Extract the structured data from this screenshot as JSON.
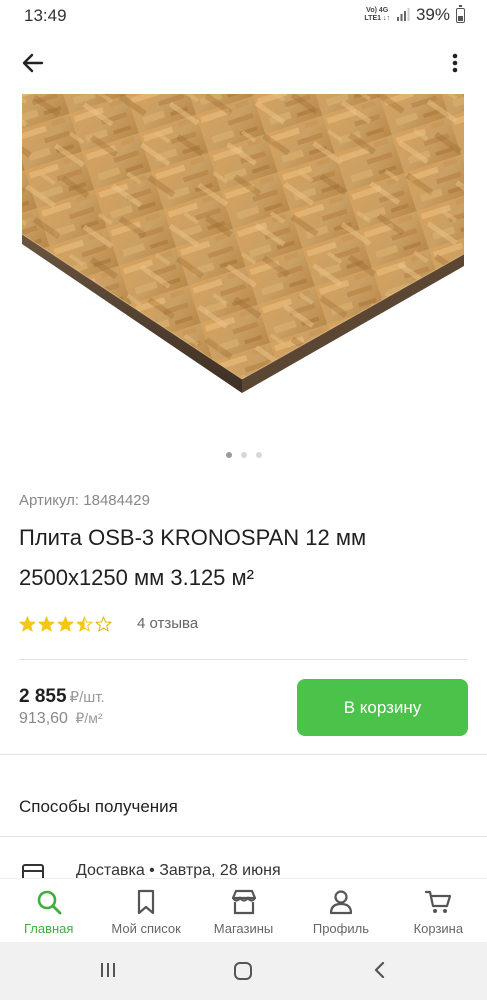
{
  "status_bar": {
    "time": "13:49",
    "net_top": "Vo) 4G",
    "net_bottom": "LTE1 ↓↑",
    "battery": "39%"
  },
  "product": {
    "sku": "Артикул: 18484429",
    "title": "Плита OSB-3 KRONOSPAN 12 мм 2500x1250 мм 3.125 м²",
    "rating": 3.5,
    "reviews": "4 отзыва",
    "image_dots": {
      "count": 3,
      "active": 0
    }
  },
  "price": {
    "main": "2 855",
    "main_unit": "₽/шт.",
    "secondary": "913,60",
    "secondary_unit": "₽/м²"
  },
  "cart_button": "В корзину",
  "delivery": {
    "section_title": "Способы получения",
    "row_text": "Доставка • Завтра, 28 июня"
  },
  "bottom_nav": [
    {
      "label": "Главная",
      "icon": "search-icon",
      "active": true
    },
    {
      "label": "Мой список",
      "icon": "bookmark-icon",
      "active": false
    },
    {
      "label": "Магазины",
      "icon": "store-icon",
      "active": false
    },
    {
      "label": "Профиль",
      "icon": "profile-icon",
      "active": false
    },
    {
      "label": "Корзина",
      "icon": "cart-icon",
      "active": false
    }
  ],
  "colors": {
    "accent": "#4bc34b",
    "star": "#f5c518",
    "active_nav": "#3fae3f"
  }
}
